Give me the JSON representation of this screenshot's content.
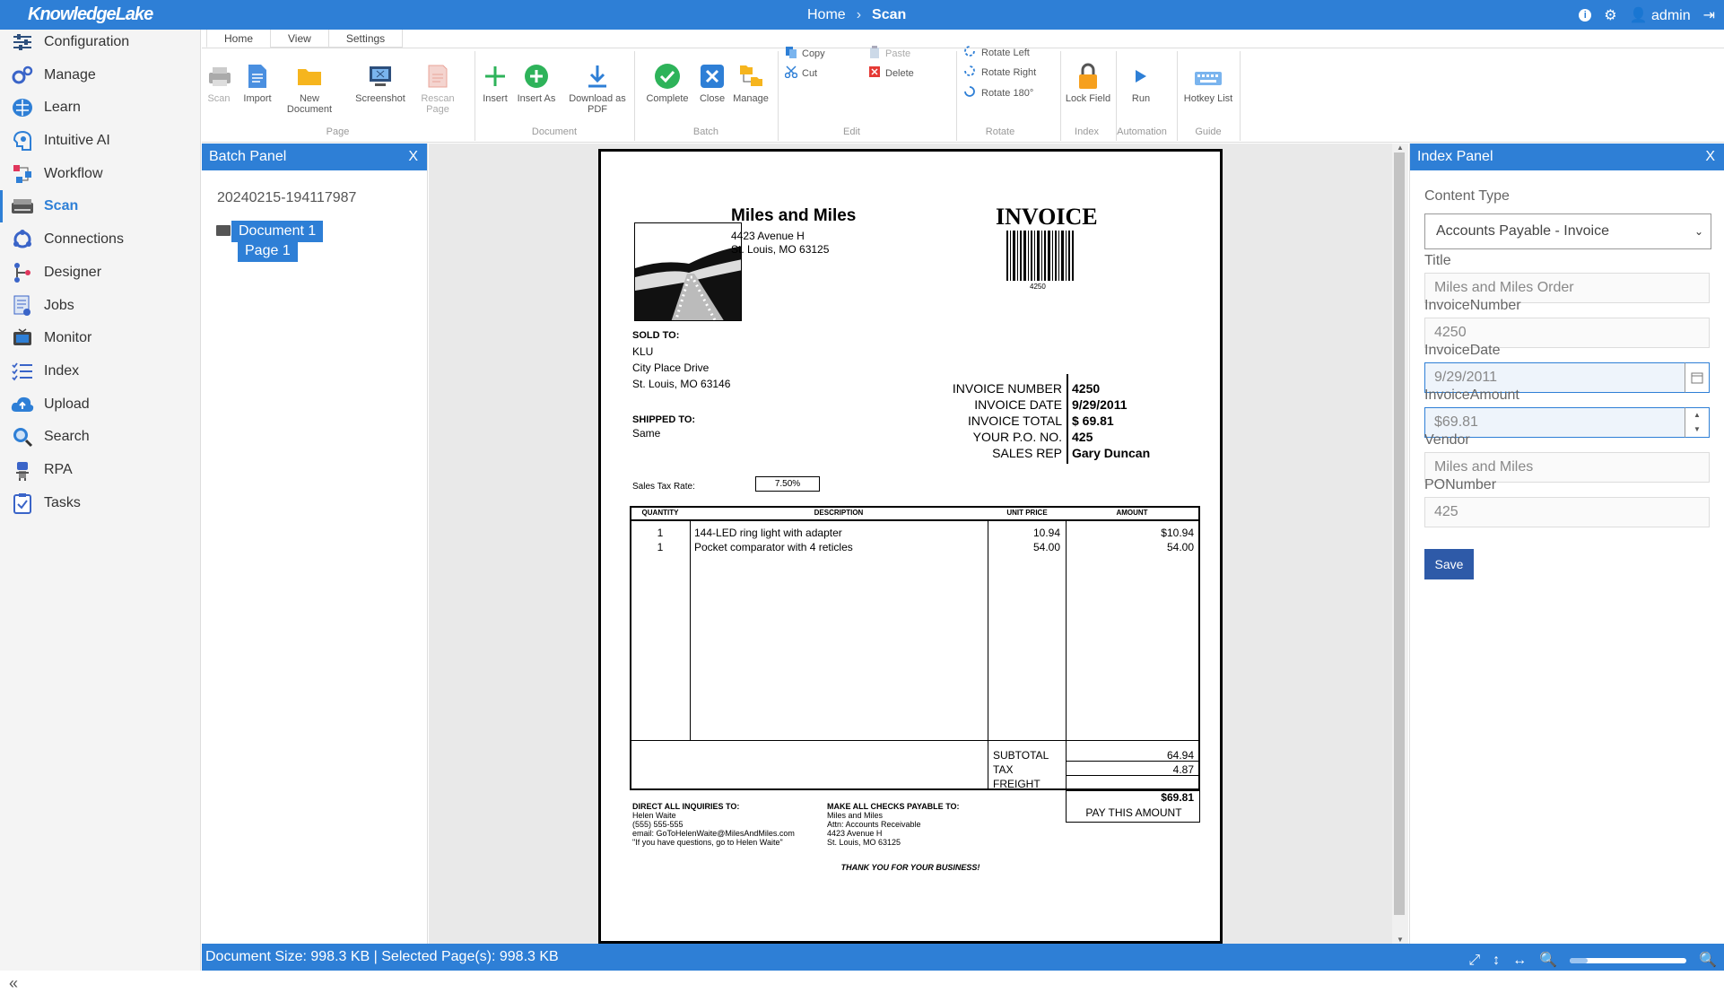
{
  "app": {
    "logo": "KnowledgeLake"
  },
  "breadcrumb": {
    "home": "Home",
    "sep": "›",
    "current": "Scan"
  },
  "topbar": {
    "user": "admin"
  },
  "sidebar": {
    "items": [
      {
        "label": "Configuration",
        "icon": "sliders-icon"
      },
      {
        "label": "Manage",
        "icon": "gears-icon"
      },
      {
        "label": "Learn",
        "icon": "brain-icon"
      },
      {
        "label": "Intuitive AI",
        "icon": "ai-head-icon"
      },
      {
        "label": "Workflow",
        "icon": "workflow-icon"
      },
      {
        "label": "Scan",
        "icon": "scanner-icon"
      },
      {
        "label": "Connections",
        "icon": "connections-icon"
      },
      {
        "label": "Designer",
        "icon": "designer-icon"
      },
      {
        "label": "Jobs",
        "icon": "jobs-icon"
      },
      {
        "label": "Monitor",
        "icon": "monitor-icon"
      },
      {
        "label": "Index",
        "icon": "list-check-icon"
      },
      {
        "label": "Upload",
        "icon": "cloud-upload-icon"
      },
      {
        "label": "Search",
        "icon": "search-icon"
      },
      {
        "label": "RPA",
        "icon": "robot-icon"
      },
      {
        "label": "Tasks",
        "icon": "clipboard-icon"
      }
    ],
    "active": "Scan"
  },
  "ribbon": {
    "tabs": [
      "Home",
      "View",
      "Settings"
    ],
    "page": {
      "scan": "Scan",
      "import": "Import",
      "new_document": "New Document",
      "screenshot": "Screenshot",
      "rescan_page": "Rescan Page",
      "group": "Page"
    },
    "document": {
      "insert": "Insert",
      "insert_as": "Insert As",
      "download_pdf_1": "Download as",
      "download_pdf_2": "PDF",
      "group": "Document"
    },
    "batch": {
      "complete": "Complete",
      "close": "Close",
      "manage": "Manage",
      "group": "Batch"
    },
    "edit": {
      "copy": "Copy",
      "cut": "Cut",
      "paste": "Paste",
      "delete": "Delete",
      "group": "Edit"
    },
    "rotate": {
      "left": "Rotate Left",
      "right": "Rotate Right",
      "r180": "Rotate 180°",
      "group": "Rotate"
    },
    "index": {
      "lock_field": "Lock Field",
      "group": "Index"
    },
    "automation": {
      "run": "Run",
      "group": "Automation"
    },
    "guide": {
      "hotkey_list": "Hotkey List",
      "group": "Guide"
    }
  },
  "batch_panel": {
    "title": "Batch Panel",
    "close": "X",
    "batch_id": "20240215-194117987",
    "document": "Document 1",
    "page": "Page 1"
  },
  "invoice": {
    "company": "Miles and Miles",
    "address1": "4423 Avenue H",
    "address2": "St. Louis, MO  63125",
    "heading": "INVOICE",
    "barcode_number": "4250",
    "sold_to_label": "SOLD TO:",
    "sold_to": [
      "KLU",
      "City Place Drive",
      "St. Louis, MO  63146"
    ],
    "shipped_to_label": "SHIPPED TO:",
    "shipped_to": "Same",
    "tax_rate_label": "Sales Tax Rate:",
    "tax_rate": "7.50%",
    "meta": [
      {
        "label": "INVOICE NUMBER",
        "value": "4250"
      },
      {
        "label": "INVOICE DATE",
        "value": "9/29/2011"
      },
      {
        "label": "INVOICE TOTAL",
        "value": "$ 69.81"
      },
      {
        "label": "YOUR P.O. NO.",
        "value": "425"
      },
      {
        "label": "SALES REP",
        "value": "Gary Duncan"
      }
    ],
    "table_headers": [
      "QUANTITY",
      "DESCRIPTION",
      "UNIT PRICE",
      "AMOUNT"
    ],
    "lines": [
      {
        "qty": "1",
        "desc": "144-LED ring light with adapter",
        "price": "10.94",
        "amount": "$10.94"
      },
      {
        "qty": "1",
        "desc": "Pocket comparator with 4 reticles",
        "price": "54.00",
        "amount": "54.00"
      }
    ],
    "subtotal_label": "SUBTOTAL",
    "subtotal": "64.94",
    "tax_label": "TAX",
    "tax": "4.87",
    "freight_label": "FREIGHT",
    "total": "$69.81",
    "pay_label": "PAY THIS AMOUNT",
    "inquiries_label": "DIRECT ALL INQUIRIES TO:",
    "inquiries": [
      "Helen Waite",
      "(555) 555-555",
      "email: GoToHelenWaite@MilesAndMiles.com",
      "\"If you have questions, go to Helen Waite\""
    ],
    "checks_label": "MAKE ALL CHECKS PAYABLE TO:",
    "checks": [
      "Miles and Miles",
      "Attn: Accounts Receivable",
      "4423 Avenue H",
      "St. Louis, MO  63125"
    ],
    "thanks": "THANK YOU FOR YOUR BUSINESS!"
  },
  "index_panel": {
    "title": "Index Panel",
    "close": "X",
    "content_type_label": "Content Type",
    "content_type": "Accounts Payable - Invoice",
    "fields": [
      {
        "label": "Title",
        "value": "Miles and Miles Order"
      },
      {
        "label": "InvoiceNumber",
        "value": "4250"
      },
      {
        "label": "InvoiceDate",
        "value": "9/29/2011"
      },
      {
        "label": "InvoiceAmount",
        "value": "$69.81"
      },
      {
        "label": "Vendor",
        "value": "Miles and Miles"
      },
      {
        "label": "PONumber",
        "value": "425"
      }
    ],
    "save": "Save"
  },
  "status": {
    "text": "Document Size: 998.3 KB | Selected Page(s): 998.3 KB",
    "zoom_fraction": 0.15
  },
  "colors": {
    "accent": "#2e7fd6",
    "save": "#2e5aa8"
  }
}
